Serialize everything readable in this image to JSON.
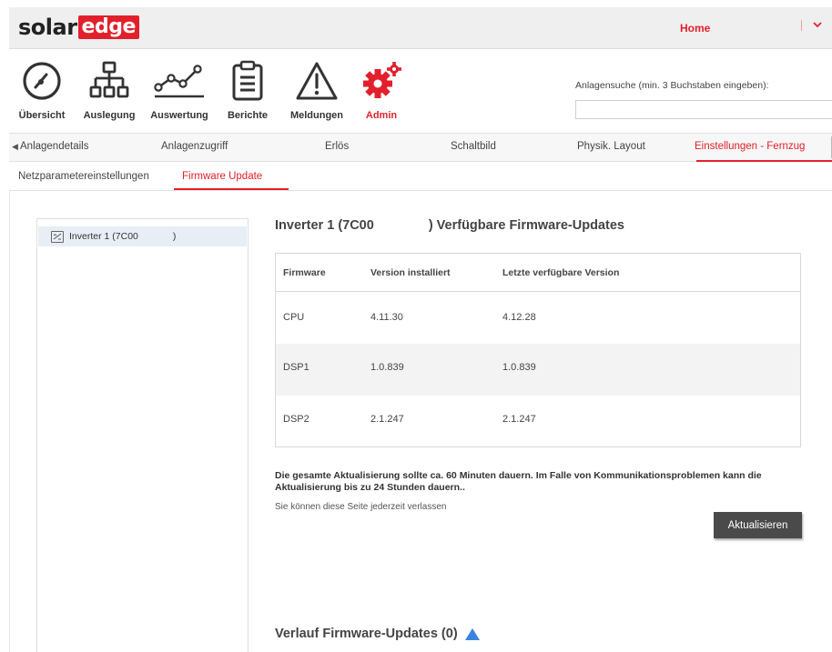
{
  "brand": {
    "part1": "solar",
    "part2": "edge",
    "accent": "#e2202c"
  },
  "header": {
    "home_label": "Home",
    "menu_chevron": "chevron-down-icon"
  },
  "nav": {
    "items": [
      {
        "label": "Übersicht",
        "icon": "gauge-icon"
      },
      {
        "label": "Auslegung",
        "icon": "hierarchy-icon"
      },
      {
        "label": "Auswertung",
        "icon": "line-chart-icon"
      },
      {
        "label": "Berichte",
        "icon": "clipboard-icon"
      },
      {
        "label": "Meldungen",
        "icon": "warning-icon"
      },
      {
        "label": "Admin",
        "icon": "gear-icon",
        "active": true
      }
    ]
  },
  "search": {
    "label": "Anlagensuche (min. 3 Buchstaben eingeben):",
    "value": "",
    "placeholder": ""
  },
  "tabs_primary": [
    {
      "label": "Anlagendetails"
    },
    {
      "label": "Anlagenzugriff"
    },
    {
      "label": "Erlös"
    },
    {
      "label": "Schaltbild"
    },
    {
      "label": "Physik. Layout"
    },
    {
      "label": "Einstellungen - Fernzug",
      "active": true
    }
  ],
  "tabs_secondary": [
    {
      "label": "Netzparametereinstellungen"
    },
    {
      "label": "Firmware Update",
      "active": true
    }
  ],
  "tree": {
    "items": [
      {
        "label": "Inverter 1 (7C00",
        "suffix": ")",
        "icon": "inverter-icon"
      }
    ]
  },
  "firmware": {
    "title_prefix": "Inverter 1 (7C00",
    "title_suffix": ") Verfügbare Firmware-Updates",
    "columns": [
      "Firmware",
      "Version installiert",
      "Letzte verfügbare Version"
    ],
    "rows": [
      [
        "CPU",
        "4.11.30",
        "4.12.28"
      ],
      [
        "DSP1",
        "1.0.839",
        "1.0.839"
      ],
      [
        "DSP2",
        "2.1.247",
        "2.1.247"
      ]
    ]
  },
  "message": {
    "bold": "Die gesamte Aktualisierung sollte ca. 60 Minuten dauern. Im Falle von Kommunikationsproblemen kann die Aktualisierung bis zu 24 Stunden dauern..",
    "sub": "Sie können diese Seite jederzeit verlassen"
  },
  "update_button": {
    "label": "Aktualisieren"
  },
  "history": {
    "title": "Verlauf Firmware-Updates (0)",
    "toggle_icon": "triangle-up-icon"
  }
}
